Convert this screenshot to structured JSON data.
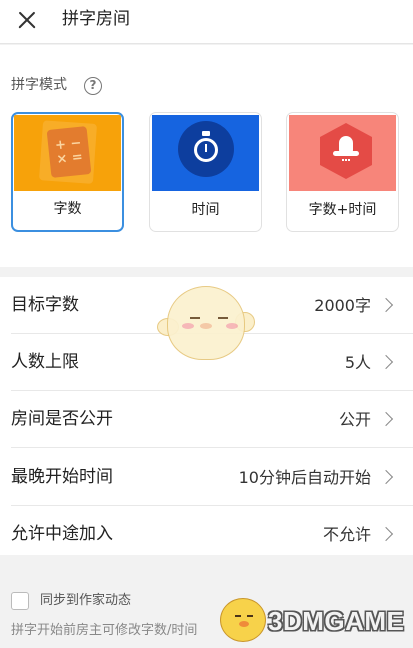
{
  "header": {
    "title": "拼字房间",
    "close_icon": "close-icon"
  },
  "mode_section": {
    "label": "拼字模式",
    "help_icon": "?",
    "modes": [
      {
        "label": "字数",
        "icon": "calculator-icon",
        "color": "#f7a20a",
        "selected": true
      },
      {
        "label": "时间",
        "icon": "stopwatch-icon",
        "color": "#1664e0",
        "selected": false
      },
      {
        "label": "字数+时间",
        "icon": "rocket-icon",
        "color": "#f7857a",
        "selected": false
      }
    ],
    "calc_glyph": "+ −\n× ="
  },
  "settings": [
    {
      "label": "目标字数",
      "value": "2000字"
    },
    {
      "label": "人数上限",
      "value": "5人"
    },
    {
      "label": "房间是否公开",
      "value": "公开"
    },
    {
      "label": "最晚开始时间",
      "value": "10分钟后自动开始"
    },
    {
      "label": "允许中途加入",
      "value": "不允许"
    }
  ],
  "sync": {
    "label": "同步到作家动态",
    "checked": false
  },
  "hint": "拼字开始前房主可修改字数/时间",
  "watermark": {
    "text": "3DMGAME"
  },
  "colors": {
    "accent": "#3b8fe0"
  }
}
